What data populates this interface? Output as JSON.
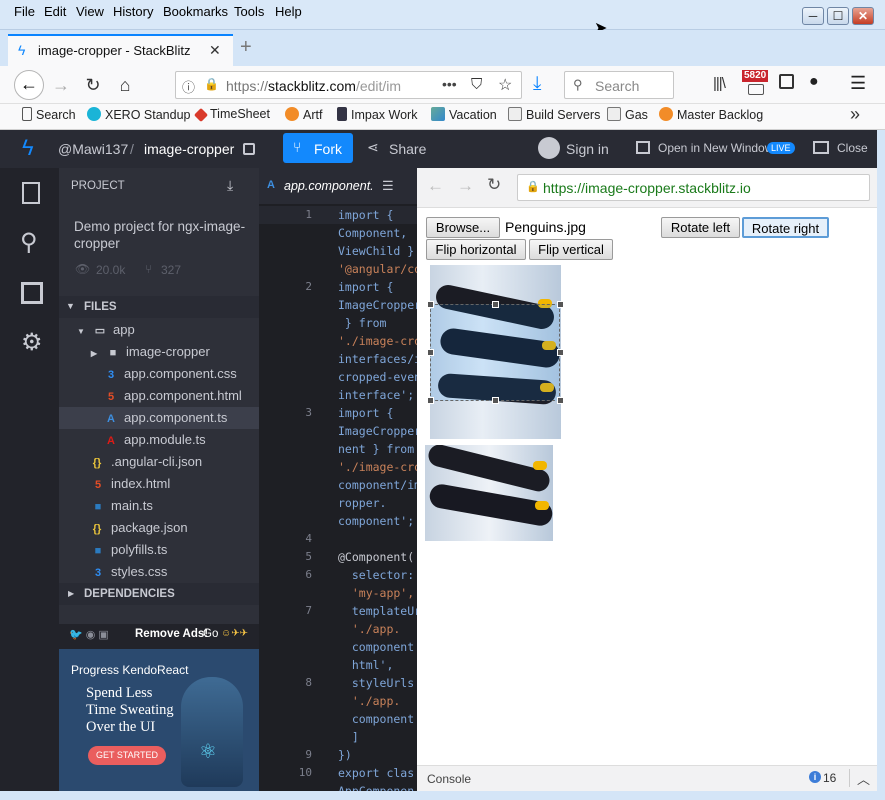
{
  "menu": [
    "File",
    "Edit",
    "View",
    "History",
    "Bookmarks",
    "Tools",
    "Help"
  ],
  "tab": {
    "title": "image-cropper - StackBlitz"
  },
  "url": {
    "scheme": "https://",
    "host": "stackblitz.com",
    "path": "/edit/im",
    "dots": "•••"
  },
  "search": {
    "placeholder": "Search"
  },
  "badge": {
    "count": "5820"
  },
  "bookmarks": [
    "Search",
    "XERO Standup",
    "TimeSheet",
    "Artf",
    "Impax Work",
    "Vacation",
    "Build Servers",
    "Gas",
    "Master Backlog"
  ],
  "header": {
    "user": "@Mawi137",
    "sep": "/",
    "project": "image-cropper",
    "fork": "Fork",
    "share": "Share",
    "signin": "Sign in",
    "open_new": "Open in New Window",
    "live": "LIVE",
    "close": "Close"
  },
  "project": {
    "heading": "PROJECT",
    "description": "Demo project for ngx-image-cropper",
    "views": "20.0k",
    "forks": "327",
    "files_heading": "FILES",
    "deps_heading": "DEPENDENCIES",
    "tree": [
      {
        "name": "app",
        "icon": "folder"
      },
      {
        "name": "image-cropper",
        "icon": "folder"
      },
      {
        "name": "app.component.css",
        "icon": "css"
      },
      {
        "name": "app.component.html",
        "icon": "html"
      },
      {
        "name": "app.component.ts",
        "icon": "angular"
      },
      {
        "name": "app.module.ts",
        "icon": "angular"
      },
      {
        "name": ".angular-cli.json",
        "icon": "json"
      },
      {
        "name": "index.html",
        "icon": "html"
      },
      {
        "name": "main.ts",
        "icon": "ts"
      },
      {
        "name": "package.json",
        "icon": "json"
      },
      {
        "name": "polyfills.ts",
        "icon": "ts"
      },
      {
        "name": "styles.css",
        "icon": "css"
      }
    ]
  },
  "ad": {
    "remove": "Remove Ads!",
    "go": "Go",
    "brand": "Progress KendoReact",
    "line1": "Spend Less",
    "line2": "Time Sweating",
    "line3": "Over the UI",
    "cta": "GET STARTED"
  },
  "editor": {
    "tab": "app.component.",
    "lines": [
      {
        "n": "1",
        "text": "import {"
      },
      {
        "n": "",
        "text": "Component,"
      },
      {
        "n": "",
        "text": "ViewChild }"
      },
      {
        "n": "",
        "text": "'@angular/co"
      },
      {
        "n": "2",
        "text": "import {"
      },
      {
        "n": "",
        "text": "ImageCropper"
      },
      {
        "n": "",
        "text": " } from"
      },
      {
        "n": "",
        "text": "'./image-cro"
      },
      {
        "n": "",
        "text": "interfaces/i"
      },
      {
        "n": "",
        "text": "cropped-even"
      },
      {
        "n": "",
        "text": "interface';"
      },
      {
        "n": "3",
        "text": "import {"
      },
      {
        "n": "",
        "text": "ImageCropper"
      },
      {
        "n": "",
        "text": "nent } from"
      },
      {
        "n": "",
        "text": "'./image-cro"
      },
      {
        "n": "",
        "text": "component/im"
      },
      {
        "n": "",
        "text": "ropper."
      },
      {
        "n": "",
        "text": "component';"
      },
      {
        "n": "4",
        "text": ""
      },
      {
        "n": "5",
        "text": "@Component("
      },
      {
        "n": "6",
        "text": "  selector:"
      },
      {
        "n": "",
        "text": "  'my-app',"
      },
      {
        "n": "7",
        "text": "  templateUr"
      },
      {
        "n": "",
        "text": "  './app."
      },
      {
        "n": "",
        "text": "  component"
      },
      {
        "n": "",
        "text": "  html',"
      },
      {
        "n": "8",
        "text": "  styleUrls"
      },
      {
        "n": "",
        "text": "  './app."
      },
      {
        "n": "",
        "text": "  component"
      },
      {
        "n": "",
        "text": "  ]"
      },
      {
        "n": "9",
        "text": "})"
      },
      {
        "n": "10",
        "text": "export clas"
      },
      {
        "n": "",
        "text": "AppComponen"
      }
    ]
  },
  "preview": {
    "url": "https://image-cropper.stackblitz.io",
    "browse": "Browse...",
    "filename": "Penguins.jpg",
    "rotate_left": "Rotate left",
    "rotate_right": "Rotate right",
    "flip_h": "Flip horizontal",
    "flip_v": "Flip vertical",
    "console": "Console",
    "info_count": "16"
  }
}
